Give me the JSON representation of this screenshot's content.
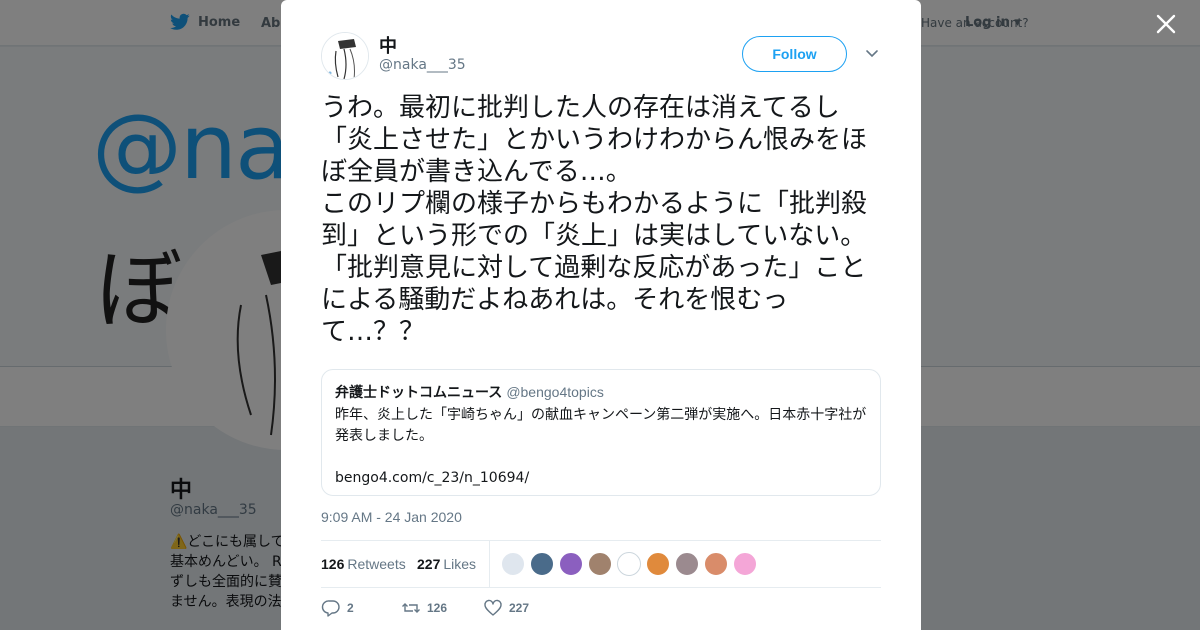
{
  "nav": {
    "home_label": "Home",
    "about_label": "About",
    "account_prompt": "Have an account?",
    "login_label": "Log in"
  },
  "banner": {
    "handle_text": "@na",
    "kana_text": "ぼな"
  },
  "background_profile": {
    "name": "中",
    "handle": "@naka___35",
    "bio": "⚠️どこにも属して\n基本めんどい。 R\nずしも全面的に賛\nません。表現の法"
  },
  "tweet": {
    "author_name": "中",
    "author_handle": "@naka___35",
    "follow_label": "Follow",
    "text": "うわ。最初に批判した人の存在は消えてるし「炎上させた」とかいうわけわからん恨みをほぼ全員が書き込んでる…。\nこのリプ欄の様子からもわかるように「批判殺到」という形での「炎上」は実はしていない。「批判意見に対して過剰な反応があった」ことによる騒動だよねあれは。それを恨むって…？？",
    "timestamp": "9:09 AM - 24 Jan 2020",
    "quote": {
      "name": "弁護士ドットコムニュース",
      "handle": "@bengo4topics",
      "text": "昨年、炎上した「宇崎ちゃん」の献血キャンペーン第二弾が実施へ。日本赤十字社が発表しました。\n\nbengo4.com/c_23/n_10694/"
    },
    "stats": {
      "retweets_count": "126",
      "retweets_label": "Retweets",
      "likes_count": "227",
      "likes_label": "Likes"
    },
    "liker_colors": [
      "#dfe6ee",
      "#4a6b8a",
      "#8b5fbf",
      "#a0826d",
      "#ffffff",
      "#e08a3c",
      "#9b8a8f",
      "#d98c6a",
      "#f4a6d7"
    ],
    "actions": {
      "replies": "2",
      "retweets": "126",
      "likes": "227"
    }
  },
  "colors": {
    "accent": "#1da1f2",
    "text": "#14171a",
    "muted": "#657786",
    "overlay": "rgba(0,0,0,0.5)"
  },
  "icons": {
    "brand": "twitter-bird-icon",
    "close": "close-icon",
    "caret": "chevron-down-icon",
    "reply": "reply-icon",
    "retweet": "retweet-icon",
    "like": "heart-icon"
  }
}
